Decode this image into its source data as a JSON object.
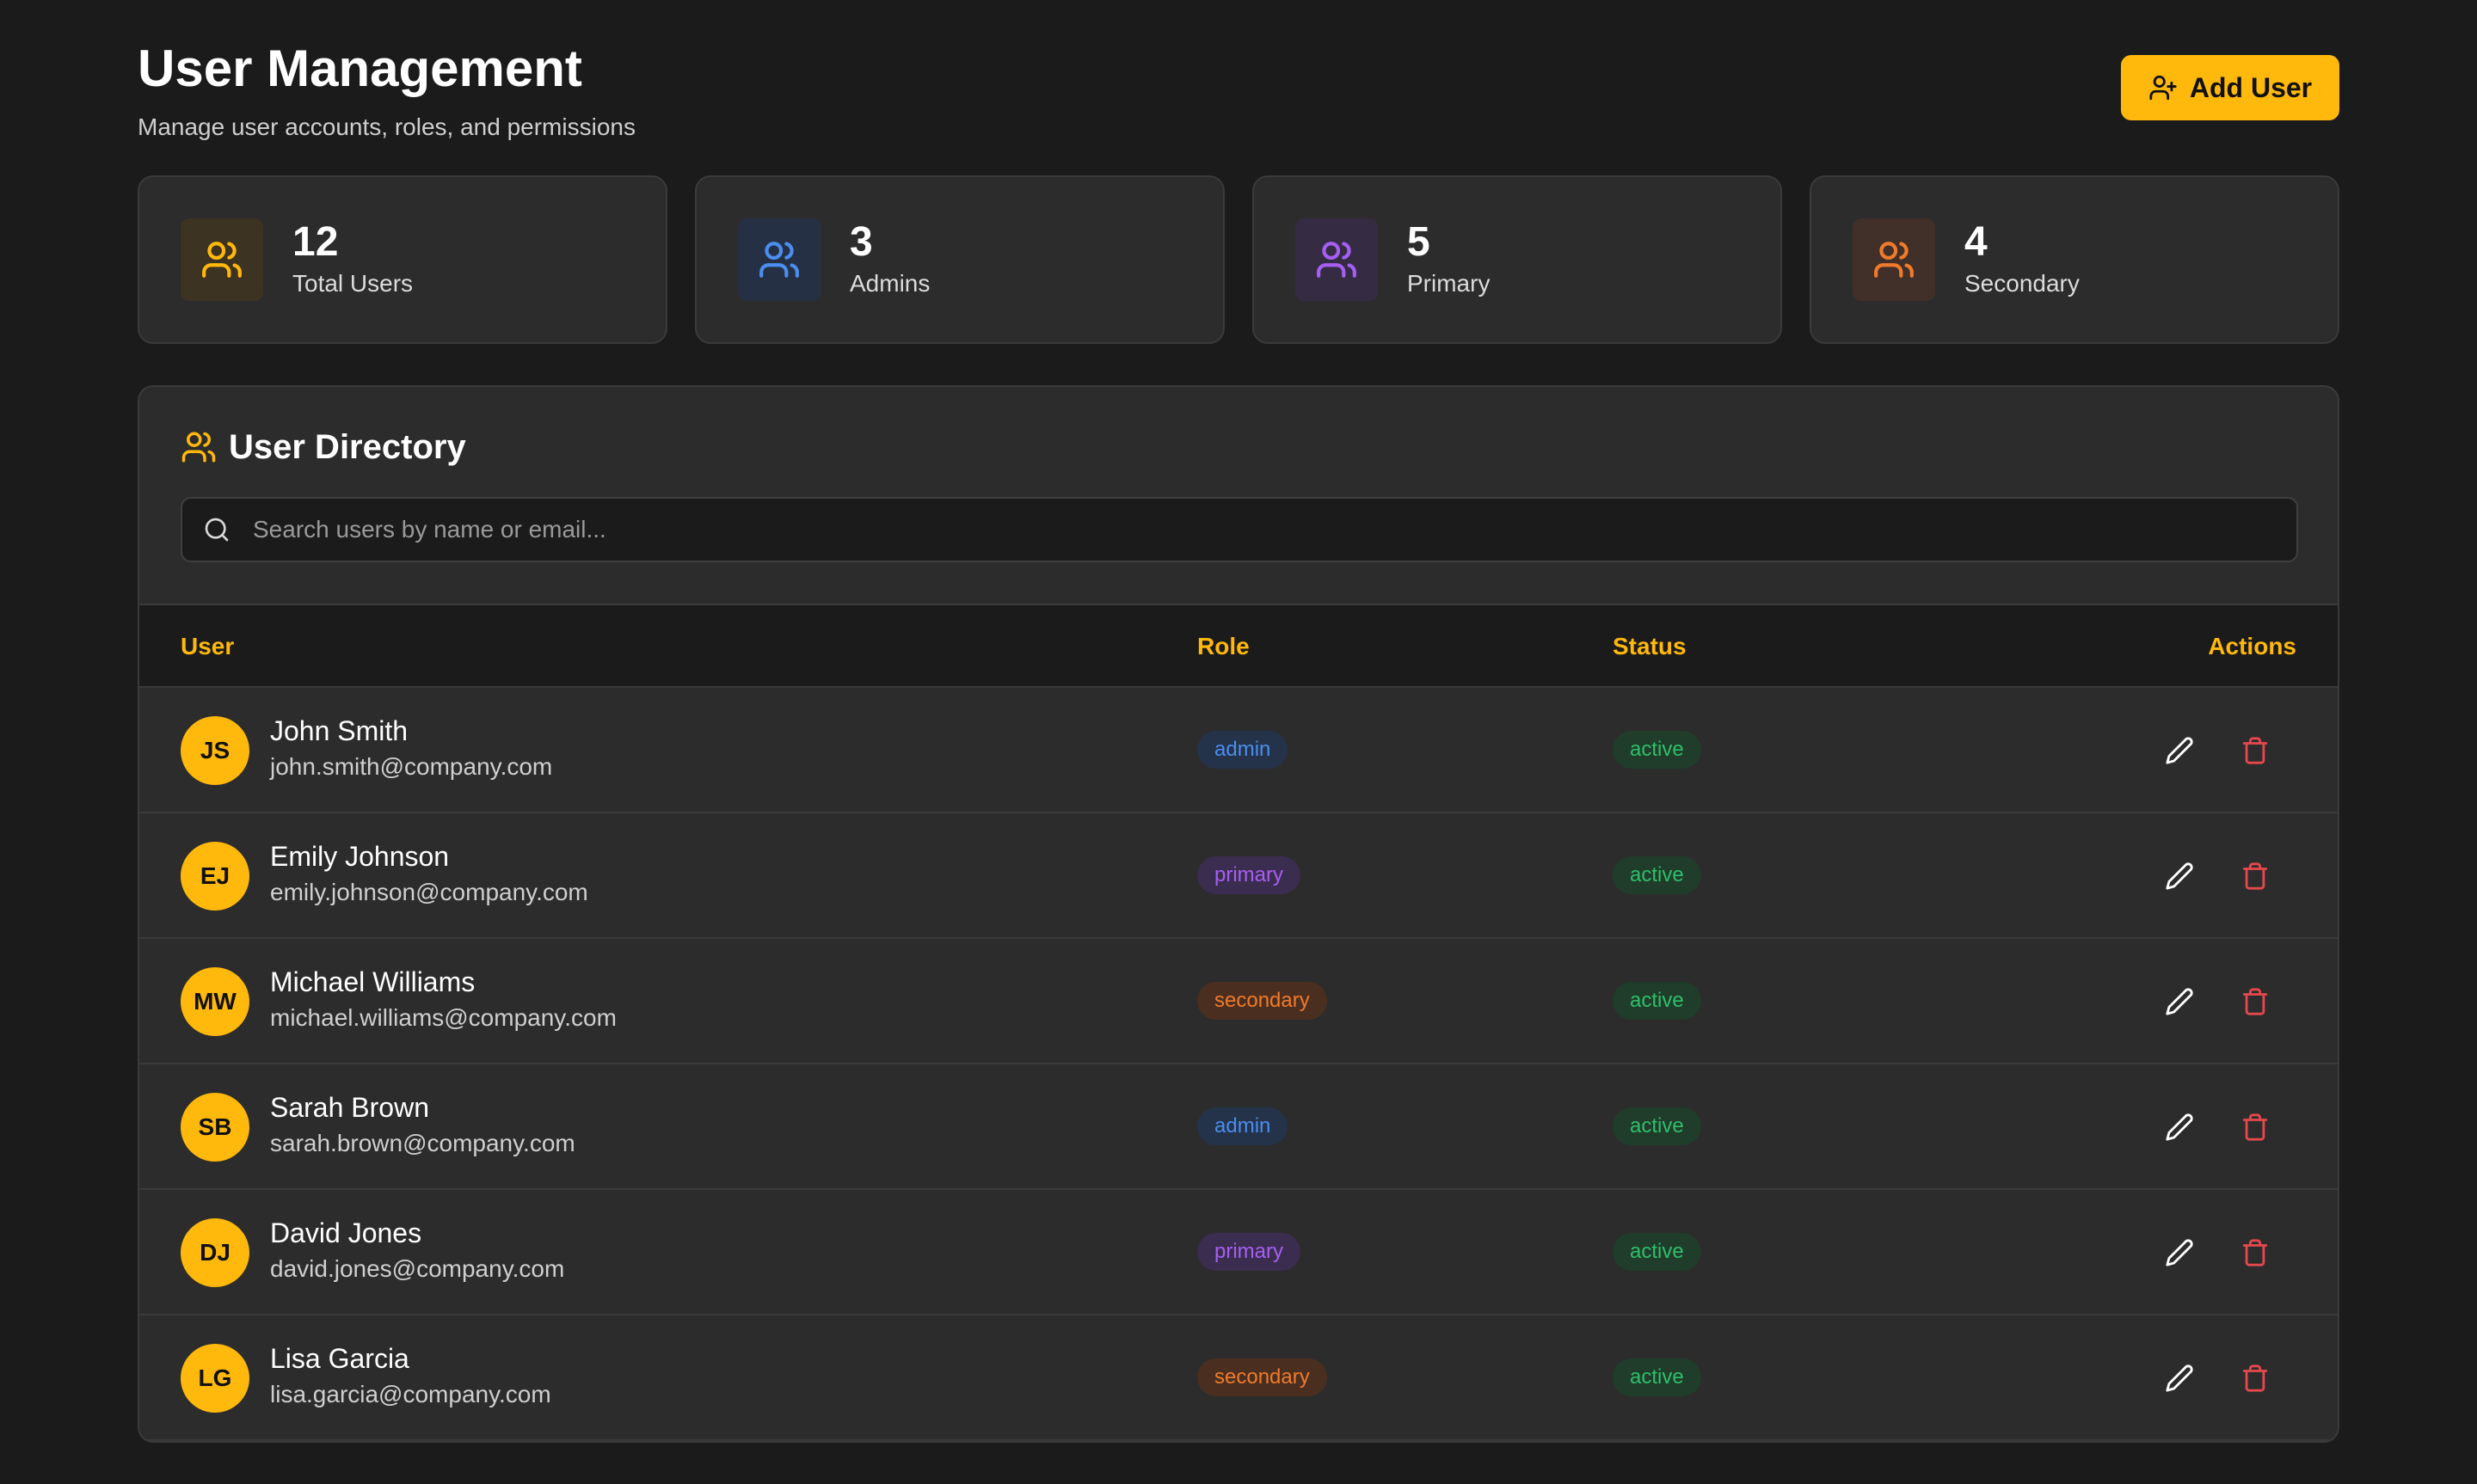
{
  "header": {
    "title": "User Management",
    "subtitle": "Manage user accounts, roles, and permissions",
    "add_button_label": "Add User"
  },
  "stats": [
    {
      "value": "12",
      "label": "Total Users",
      "icon": "users-icon",
      "color": "#ffb80c",
      "bg": "#3d3322"
    },
    {
      "value": "3",
      "label": "Admins",
      "icon": "users-icon",
      "color": "#4a8ef0",
      "bg": "#263044"
    },
    {
      "value": "5",
      "label": "Primary",
      "icon": "users-icon",
      "color": "#a65ff2",
      "bg": "#352c44"
    },
    {
      "value": "4",
      "label": "Secondary",
      "icon": "users-icon",
      "color": "#f07a2a",
      "bg": "#41302a"
    }
  ],
  "directory": {
    "title": "User Directory",
    "search_placeholder": "Search users by name or email...",
    "columns": {
      "user": "User",
      "role": "Role",
      "status": "Status",
      "actions": "Actions"
    },
    "users": [
      {
        "initials": "JS",
        "name": "John Smith",
        "email": "john.smith@company.com",
        "role": "admin",
        "status": "active"
      },
      {
        "initials": "EJ",
        "name": "Emily Johnson",
        "email": "emily.johnson@company.com",
        "role": "primary",
        "status": "active"
      },
      {
        "initials": "MW",
        "name": "Michael Williams",
        "email": "michael.williams@company.com",
        "role": "secondary",
        "status": "active"
      },
      {
        "initials": "SB",
        "name": "Sarah Brown",
        "email": "sarah.brown@company.com",
        "role": "admin",
        "status": "active"
      },
      {
        "initials": "DJ",
        "name": "David Jones",
        "email": "david.jones@company.com",
        "role": "primary",
        "status": "active"
      },
      {
        "initials": "LG",
        "name": "Lisa Garcia",
        "email": "lisa.garcia@company.com",
        "role": "secondary",
        "status": "active"
      }
    ]
  },
  "colors": {
    "accent": "#ffb80c",
    "background": "#1b1b1b",
    "card": "#2c2c2c",
    "edit_icon": "#ffffff",
    "delete_icon": "#e5484d"
  }
}
